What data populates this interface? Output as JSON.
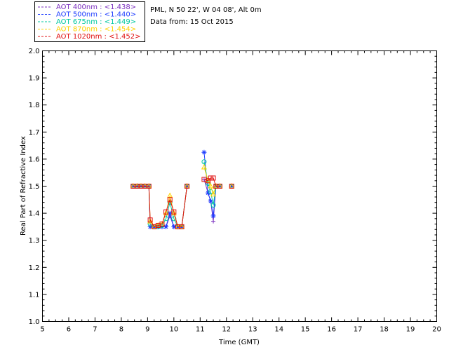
{
  "chart_data": {
    "type": "line",
    "title": "",
    "info_lines": [
      "PML, N 50 22', W 04 08', Alt 0m",
      "Data from: 15 Oct 2015"
    ],
    "xlabel": "Time (GMT)",
    "ylabel": "Real Part of Refractive Index",
    "xlim": [
      5,
      20
    ],
    "ylim": [
      1.0,
      2.0
    ],
    "xticks": [
      "5",
      "6",
      "7",
      "8",
      "9",
      "10",
      "11",
      "12",
      "13",
      "14",
      "15",
      "16",
      "17",
      "18",
      "19",
      "20"
    ],
    "yticks": [
      "1.0",
      "1.1",
      "1.2",
      "1.3",
      "1.4",
      "1.5",
      "1.6",
      "1.7",
      "1.8",
      "1.9",
      "2.0"
    ],
    "grid": false,
    "legend_position": "top-left",
    "series": [
      {
        "name": "AOT  400nm : <1.438>",
        "color": "#7b2fbf",
        "marker": "plus",
        "x": [
          8.45,
          8.6,
          8.75,
          8.9,
          9.05,
          9.1,
          9.25,
          9.4,
          9.55,
          9.7,
          9.85,
          10.0,
          10.15,
          10.3,
          10.5,
          11.15,
          11.3,
          11.4,
          11.5,
          11.6,
          11.75,
          12.2
        ],
        "y": [
          1.5,
          1.5,
          1.5,
          1.5,
          1.5,
          1.35,
          1.35,
          1.35,
          1.35,
          1.35,
          1.39,
          1.35,
          1.35,
          1.35,
          1.5,
          1.525,
          1.475,
          1.445,
          1.37,
          1.5,
          1.5,
          1.5
        ]
      },
      {
        "name": "AOT  500nm : <1.440>",
        "color": "#1e3cff",
        "marker": "star",
        "x": [
          8.45,
          8.6,
          8.75,
          8.9,
          9.05,
          9.1,
          9.25,
          9.4,
          9.55,
          9.7,
          9.85,
          10.0,
          10.15,
          10.3,
          10.5,
          11.15,
          11.3,
          11.4,
          11.5,
          11.6,
          11.75,
          12.2
        ],
        "y": [
          1.5,
          1.5,
          1.5,
          1.5,
          1.5,
          1.35,
          1.35,
          1.35,
          1.35,
          1.35,
          1.4,
          1.35,
          1.35,
          1.35,
          1.5,
          1.625,
          1.475,
          1.445,
          1.39,
          1.5,
          1.5,
          1.5
        ]
      },
      {
        "name": "AOT  675nm : <1.449>",
        "color": "#00c8a0",
        "marker": "circle",
        "x": [
          8.45,
          8.6,
          8.75,
          8.9,
          9.05,
          9.1,
          9.25,
          9.4,
          9.55,
          9.7,
          9.85,
          10.0,
          10.15,
          10.3,
          10.5,
          11.15,
          11.3,
          11.4,
          11.5,
          11.6,
          11.75,
          12.2
        ],
        "y": [
          1.5,
          1.5,
          1.5,
          1.5,
          1.5,
          1.36,
          1.35,
          1.35,
          1.355,
          1.38,
          1.44,
          1.38,
          1.35,
          1.35,
          1.5,
          1.59,
          1.51,
          1.48,
          1.43,
          1.5,
          1.5,
          1.5
        ]
      },
      {
        "name": "AOT  870nm : <1.454>",
        "color": "#ffd200",
        "marker": "triangle",
        "x": [
          8.45,
          8.6,
          8.75,
          8.9,
          9.05,
          9.1,
          9.25,
          9.4,
          9.55,
          9.7,
          9.85,
          10.0,
          10.15,
          10.3,
          10.5,
          11.15,
          11.3,
          11.4,
          11.5,
          11.6,
          11.75,
          12.2
        ],
        "y": [
          1.5,
          1.5,
          1.5,
          1.5,
          1.5,
          1.37,
          1.35,
          1.355,
          1.36,
          1.4,
          1.465,
          1.4,
          1.35,
          1.35,
          1.5,
          1.57,
          1.52,
          1.5,
          1.47,
          1.5,
          1.5,
          1.5
        ]
      },
      {
        "name": "AOT 1020nm : <1.452>",
        "color": "#e01010",
        "marker": "square",
        "x": [
          8.45,
          8.6,
          8.75,
          8.9,
          9.05,
          9.1,
          9.25,
          9.4,
          9.55,
          9.7,
          9.85,
          10.0,
          10.15,
          10.3,
          10.5,
          11.15,
          11.3,
          11.4,
          11.5,
          11.6,
          11.75,
          12.2
        ],
        "y": [
          1.5,
          1.5,
          1.5,
          1.5,
          1.5,
          1.375,
          1.35,
          1.355,
          1.36,
          1.405,
          1.45,
          1.405,
          1.35,
          1.35,
          1.5,
          1.525,
          1.52,
          1.53,
          1.53,
          1.5,
          1.5,
          1.5
        ]
      }
    ]
  }
}
